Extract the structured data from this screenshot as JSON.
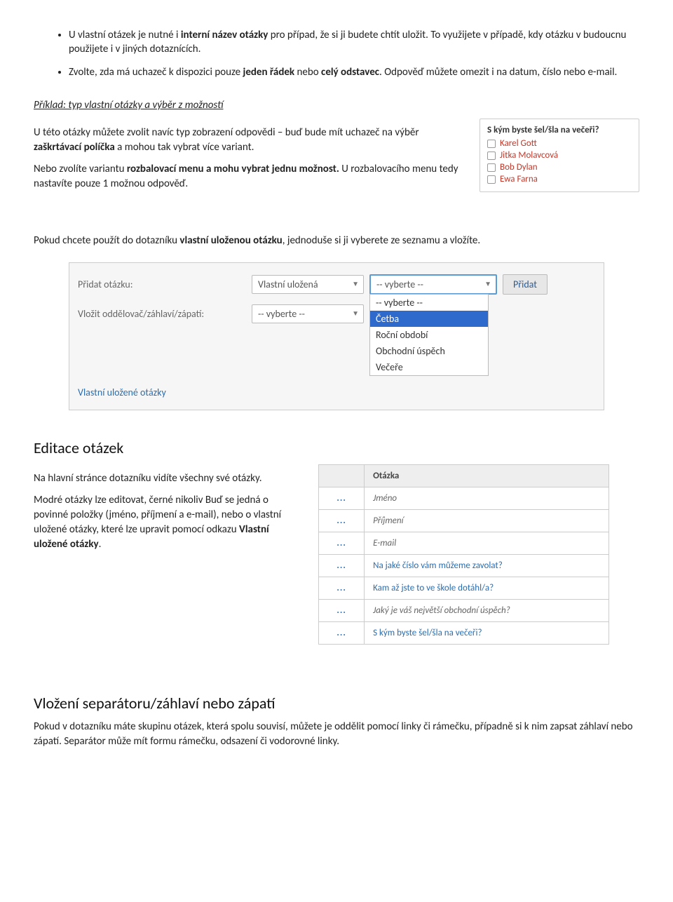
{
  "bullets": {
    "b1_pre": "U vlastní otázek je nutné  i ",
    "b1_bold": "interní název otázky",
    "b1_post": " pro případ, že si ji budete chtít uložit. To využijete v případě, kdy otázku v budoucnu použijete i v jiných dotaznících.",
    "b2_pre": "Zvolte, zda má uchazeč k dispozici pouze ",
    "b2_bold1": "jeden řádek",
    "b2_mid": " nebo ",
    "b2_bold2": "celý odstavec",
    "b2_post": ". Odpověď můžete omezit i na datum, číslo nebo e-mail."
  },
  "example_heading": "Příklad: typ vlastní otázky a výběr z možností",
  "example_p1_pre": "U této otázky můžete zvolit navíc typ zobrazení odpovědi – buď bude mít uchazeč na výběr ",
  "example_p1_bold": "zaškrtávací políčka",
  "example_p1_post": " a mohou tak vybrat více variant.",
  "example_p2_pre": "Nebo zvolíte variantu ",
  "example_p2_bold": "rozbalovací menu a mohu vybrat jednu možnost.",
  "example_p2_post": " U rozbalovacího menu tedy nastavíte pouze 1 možnou odpověď.",
  "poll_box": {
    "question": "S kým byste šel/šla na večeři?",
    "options": [
      "Karel Gott",
      "Jitka Molavcová",
      "Bob Dylan",
      "Ewa Farna"
    ]
  },
  "stored_q_pre": "Pokud chcete použít do dotazníku ",
  "stored_q_bold": "vlastní uloženou otázku",
  "stored_q_post": ", jednoduše si ji vyberete ze seznamu a vložíte.",
  "form": {
    "label_add": "Přidat otázku:",
    "select1": "Vlastní uložená",
    "select2": "-- vyberte --",
    "btn": "Přidat",
    "dropdown": [
      "-- vyberte --",
      "Četba",
      "Roční období",
      "Obchodní úspěch",
      "Večeře"
    ],
    "dropdown_selected": "Četba",
    "label_sep": "Vložit oddělovač/záhlaví/zápatí:",
    "select3": "-- vyberte --",
    "link": "Vlastní uložené otázky"
  },
  "edit_heading": "Editace otázek",
  "edit_p1": "Na hlavní stránce dotazníku vidíte  všechny své otázky.",
  "edit_p2_pre": "Modré otázky lze editovat, černé nikoliv  Buď se jedná o povinné položky (jméno, příjmení a e-mail), nebo o vlastní uložené otázky, které lze upravit pomocí odkazu ",
  "edit_p2_bold": "Vlastní uložené otázky",
  "edit_p2_post": ".",
  "table": {
    "header": "Otázka",
    "rows": [
      {
        "text": "Jméno",
        "editable": false
      },
      {
        "text": "Příjmení",
        "editable": false
      },
      {
        "text": "E-mail",
        "editable": false
      },
      {
        "text": "Na jaké číslo vám můžeme zavolat?",
        "editable": true
      },
      {
        "text": "Kam až jste to ve škole dotáhl/a?",
        "editable": true
      },
      {
        "text": "Jaký je váš největší obchodní úspěch?",
        "editable": false
      },
      {
        "text": "S kým byste šel/šla na večeři?",
        "editable": true
      }
    ]
  },
  "sep_heading": "Vložení separátoru/záhlaví nebo zápatí",
  "sep_p": "Pokud v dotazníku máte skupinu otázek, která spolu souvisí, můžete je oddělit pomocí linky či rámečku, případně si k nim zapsat  záhlaví nebo zápatí. Separátor může mít formu rámečku, odsazení či vodorovné linky."
}
